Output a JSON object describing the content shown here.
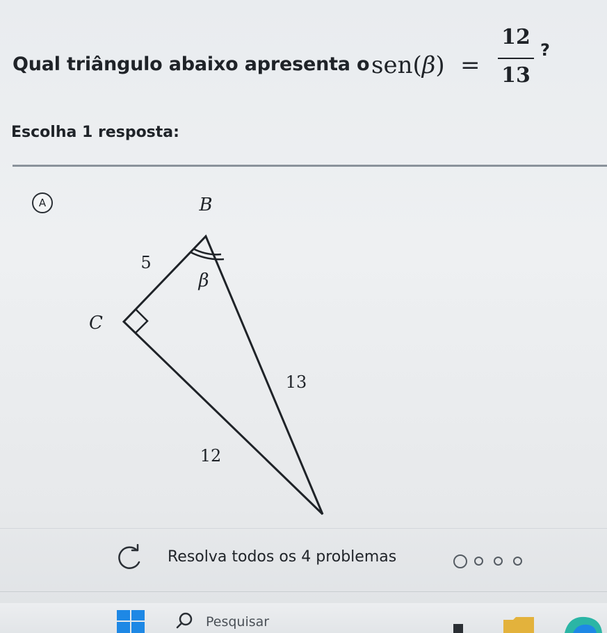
{
  "question": {
    "text": "Qual triângulo abaixo apresenta o",
    "math": {
      "function": "sen(",
      "variable": "β",
      "close": ")",
      "equals": "=",
      "numerator": "12",
      "denominator": "13"
    },
    "suffix": "?"
  },
  "instruction": "Escolha 1 resposta:",
  "option": {
    "letter": "A",
    "figure": {
      "vertex_b": "B",
      "vertex_c": "C",
      "angle_label": "β",
      "side_bc": "5",
      "side_ca": "12",
      "side_ab": "13"
    }
  },
  "progress": {
    "text": "Resolva todos os 4 problemas",
    "total_problems": 4,
    "completed_problems": 0
  },
  "taskbar": {
    "search_placeholder": "Pesquisar"
  },
  "colors": {
    "text": "#1f2328",
    "divider": "#8a929b",
    "windows_blue": "#1e88e5",
    "tray_yellow": "#e3b23c",
    "tray_teal": "#2bb5a5"
  },
  "icons": [
    "refresh-icon",
    "windows-start-icon",
    "search-icon"
  ]
}
